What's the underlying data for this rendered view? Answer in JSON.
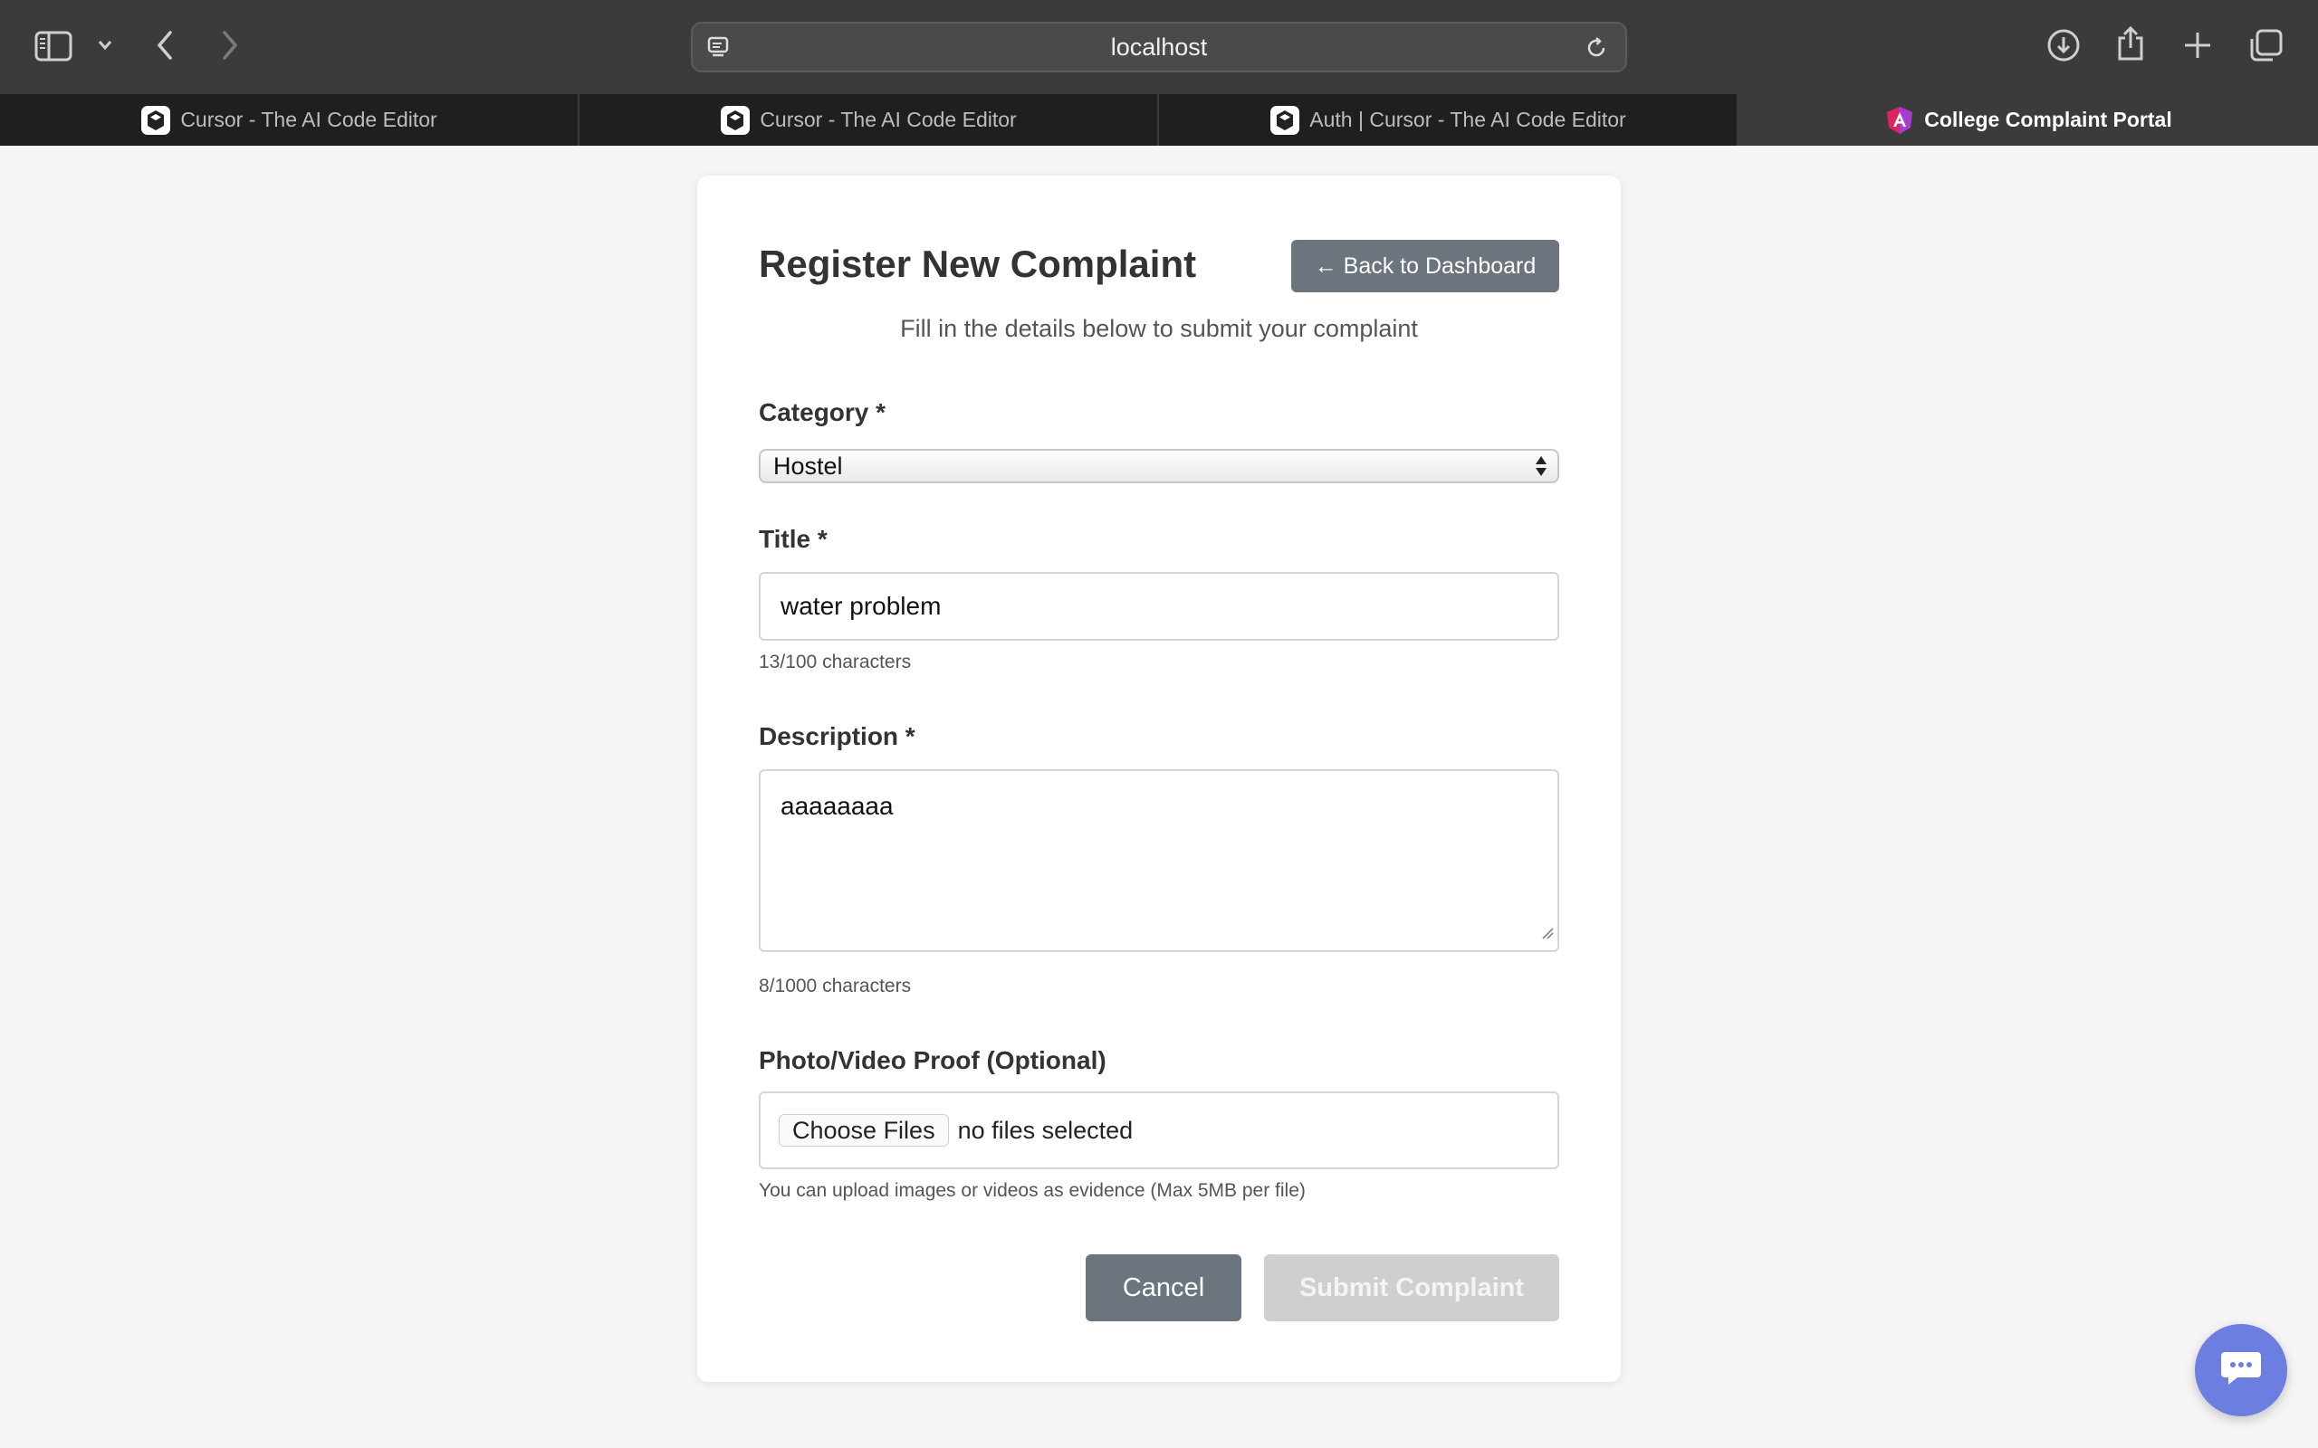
{
  "browser": {
    "url": "localhost",
    "tabs": [
      {
        "label": "Cursor - The AI Code Editor",
        "active": false
      },
      {
        "label": "Cursor - The AI Code Editor",
        "active": false
      },
      {
        "label": "Auth | Cursor - The AI Code Editor",
        "active": false
      },
      {
        "label": "College Complaint Portal",
        "active": true
      }
    ]
  },
  "form": {
    "title": "Register New Complaint",
    "back_label": "← Back to Dashboard",
    "subtitle": "Fill in the details below to submit your complaint",
    "category": {
      "label": "Category *",
      "value": "Hostel"
    },
    "title_field": {
      "label": "Title *",
      "value": "water problem",
      "count": "13/100 characters"
    },
    "description": {
      "label": "Description *",
      "value": "aaaaaaaa",
      "count": "8/1000 characters"
    },
    "proof": {
      "label": "Photo/Video Proof (Optional)",
      "choose_label": "Choose Files",
      "status": "no files selected",
      "hint": "You can upload images or videos as evidence (Max 5MB per file)"
    },
    "cancel_label": "Cancel",
    "submit_label": "Submit Complaint"
  },
  "colors": {
    "secondary_button": "#6c757d",
    "disabled_button": "#cfcfcf",
    "chat_button": "#6c7fe0"
  }
}
